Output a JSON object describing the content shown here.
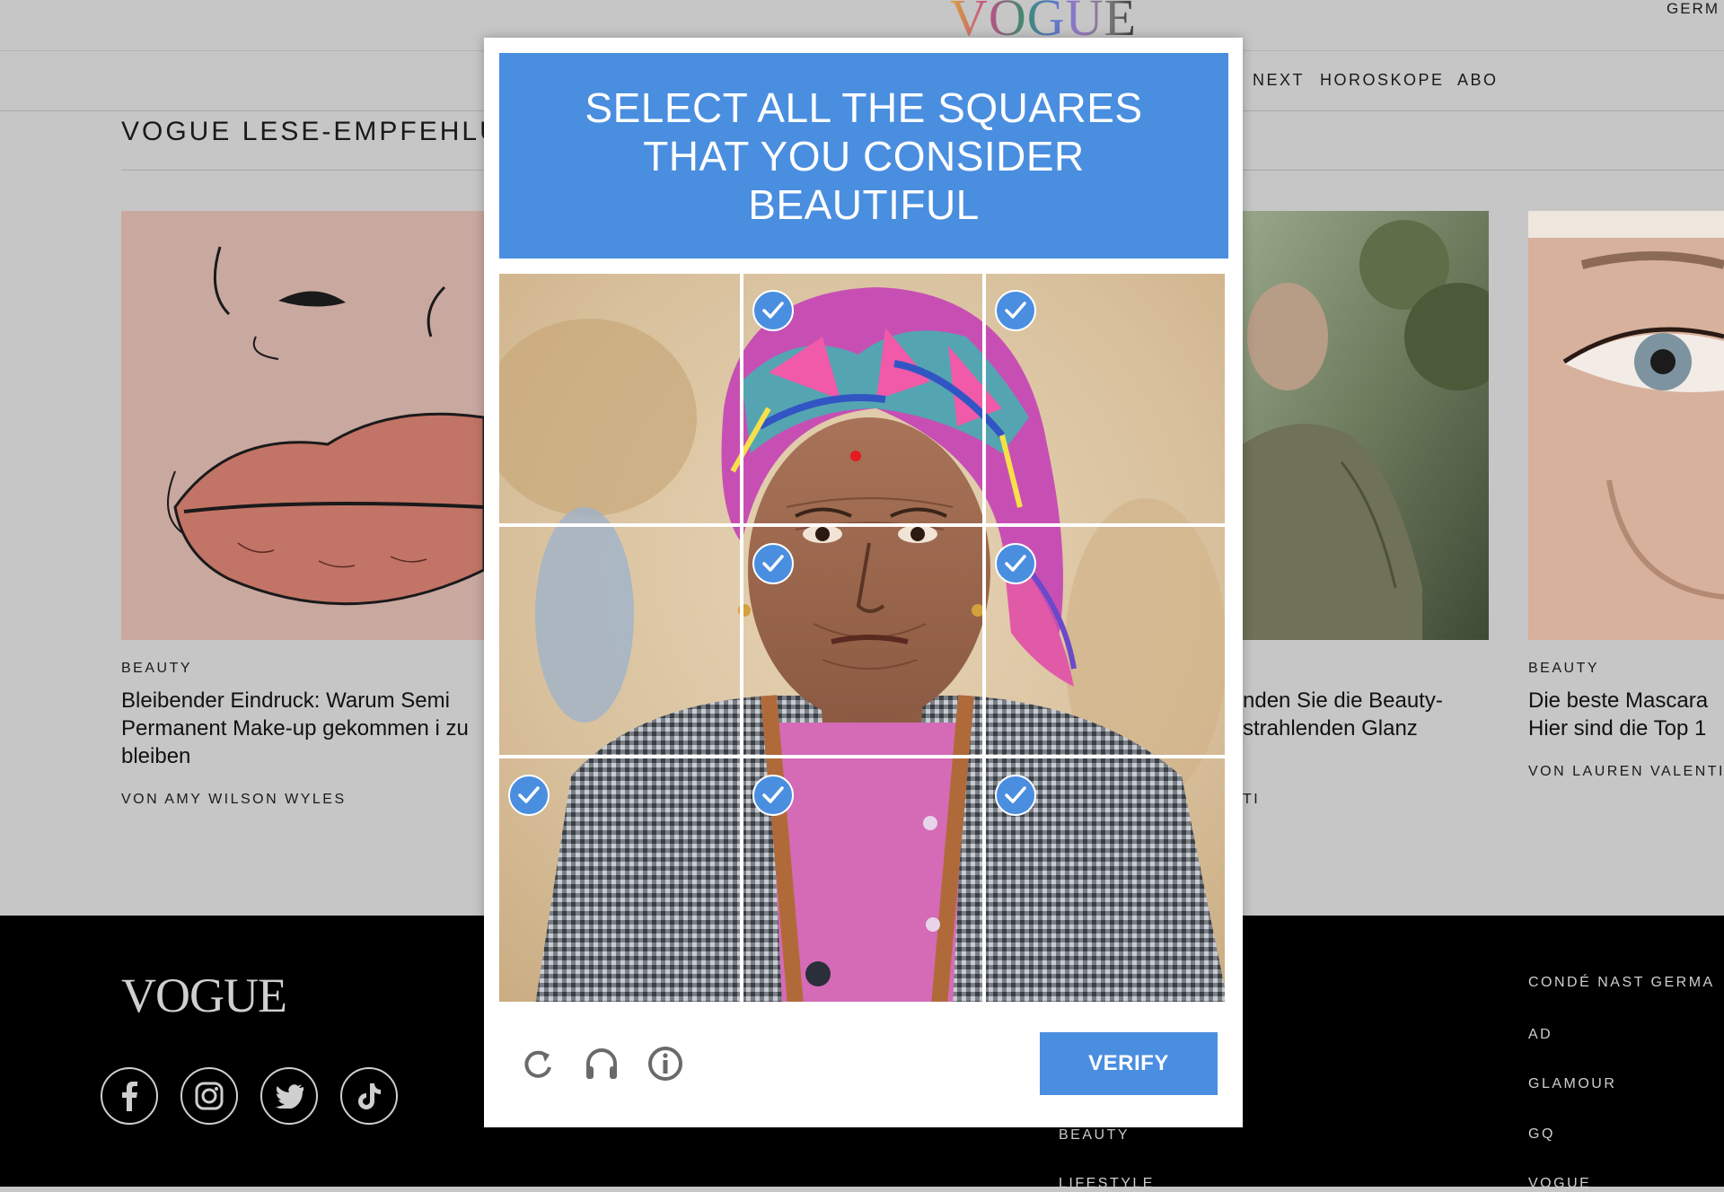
{
  "header": {
    "logo": "VOGUE",
    "region": "GERM",
    "nav": [
      "NEXT",
      "HOROSKOPE",
      "ABO"
    ]
  },
  "section": {
    "title": "VOGUE LESE-EMPFEHLUN"
  },
  "cards": [
    {
      "category": "BEAUTY",
      "title": "Bleibender Eindruck: Warum Semi Permanent Make-up gekommen i zu bleiben",
      "author": "VON AMY WILSON WYLES"
    },
    {
      "category": "",
      "title": "nden Sie die Beauty- strahlenden Glanz",
      "author": "TI"
    },
    {
      "category": "BEAUTY",
      "title": "Die beste Mascara Hier sind die Top 1",
      "author": "VON LAUREN VALENTI"
    }
  ],
  "footer": {
    "logo": "VOGUE",
    "social": [
      "facebook-icon",
      "instagram-icon",
      "twitter-icon",
      "tiktok-icon"
    ],
    "links_col1": [
      "BEAUTY",
      "LIFESTYLE"
    ],
    "links_col2_heading": "CONDÉ NAST GERMA",
    "links_col2": [
      "AD",
      "GLAMOUR",
      "GQ",
      "VOGUE"
    ]
  },
  "captcha": {
    "prompt": "SELECT ALL THE SQUARES THAT YOU CONSIDER BEAUTIFUL",
    "accent_color": "#4a8ee0",
    "tiles_selected": [
      false,
      true,
      true,
      false,
      true,
      true,
      true,
      true,
      true
    ],
    "icons": [
      "refresh-icon",
      "headphones-icon",
      "info-icon"
    ],
    "verify_label": "VERIFY"
  }
}
